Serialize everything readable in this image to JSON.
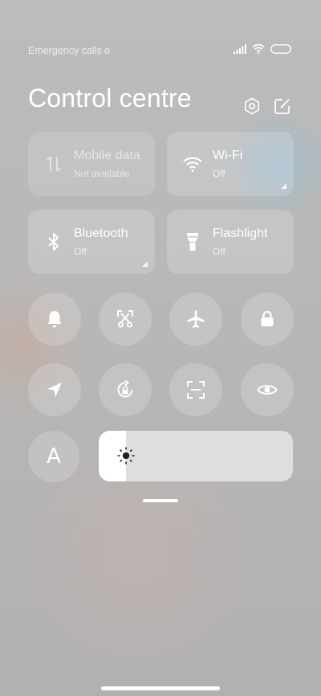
{
  "status_bar": {
    "carrier_text": "Emergency calls o",
    "icons": [
      "signal-icon",
      "wifi-icon",
      "battery-icon"
    ]
  },
  "header": {
    "title": "Control centre",
    "icons": [
      "settings-icon",
      "edit-icon"
    ]
  },
  "tiles": [
    {
      "label": "Mobile data",
      "status": "Not available",
      "icon": "mobile-data-icon",
      "active": false
    },
    {
      "label": "Wi-Fi",
      "status": "Off",
      "icon": "wifi-icon",
      "active": false
    },
    {
      "label": "Bluetooth",
      "status": "Off",
      "icon": "bluetooth-icon",
      "active": false
    },
    {
      "label": "Flashlight",
      "status": "Off",
      "icon": "flashlight-icon",
      "active": false
    }
  ],
  "toggles_row1": [
    "bell-icon",
    "screenshot-scissors-icon",
    "airplane-icon",
    "lock-icon"
  ],
  "toggles_row2": [
    "location-icon",
    "rotation-lock-icon",
    "scan-icon",
    "eye-icon"
  ],
  "auto_brightness": {
    "label": "A"
  },
  "brightness": {
    "level": 0.14,
    "icon": "sun-icon"
  },
  "colors": {
    "tile_bg": "rgba(255,255,255,0.18)",
    "slider_fill": "#ffffff",
    "text": "#ffffff"
  }
}
